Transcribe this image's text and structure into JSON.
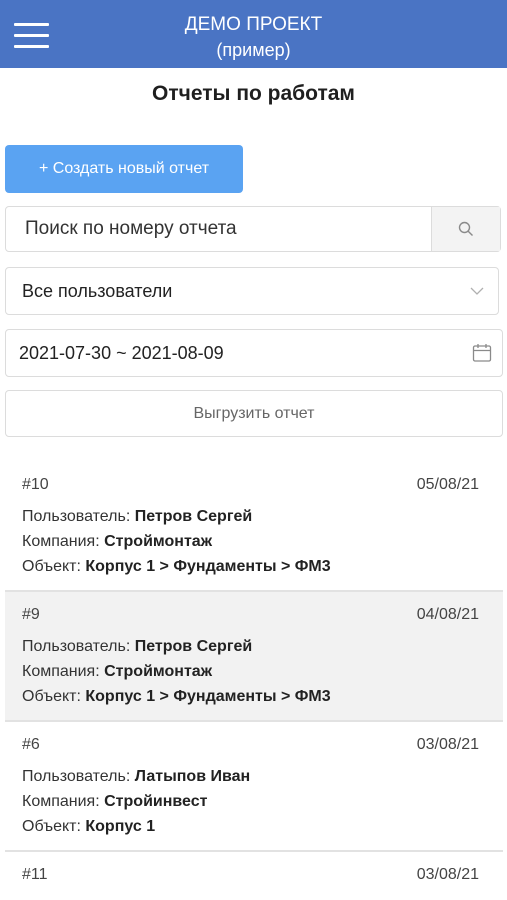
{
  "header": {
    "title": "ДЕМО ПРОЕКТ",
    "subtitle": "(пример)",
    "menu_icon": "hamburger-menu-icon",
    "color": "#4a74c4"
  },
  "page": {
    "title": "Отчеты по работам"
  },
  "toolbar": {
    "create_label": "+ Создать новый отчет",
    "create_color": "#5aa3f2",
    "search_placeholder": "Поиск по номеру отчета",
    "search_icon": "search-icon",
    "user_filter_value": "Все пользователи",
    "date_range_value": "2021-07-30 ~ 2021-08-09",
    "calendar_icon": "calendar-icon",
    "export_label": "Выгрузить отчет"
  },
  "labels": {
    "user": "Пользователь:",
    "company": "Компания:",
    "object": "Объект:"
  },
  "reports": [
    {
      "number": "#10",
      "date": "05/08/21",
      "user": "Петров Сергей",
      "company": "Строймонтаж",
      "object": "Корпус 1 > Фундаменты > ФМ3"
    },
    {
      "number": "#9",
      "date": "04/08/21",
      "user": "Петров Сергей",
      "company": "Строймонтаж",
      "object": "Корпус 1 > Фундаменты > ФМ3"
    },
    {
      "number": "#6",
      "date": "03/08/21",
      "user": "Латыпов Иван",
      "company": "Стройинвест",
      "object": "Корпус 1"
    },
    {
      "number": "#11",
      "date": "03/08/21"
    }
  ]
}
